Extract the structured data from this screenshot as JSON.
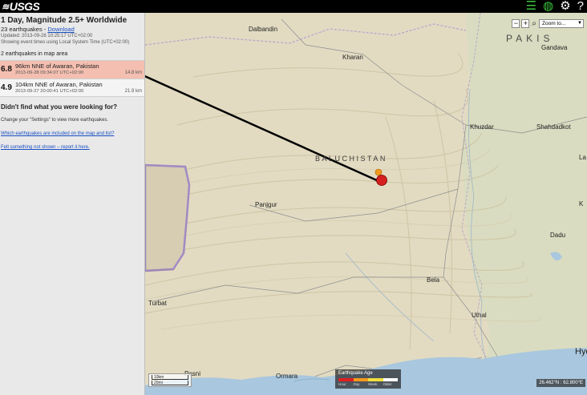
{
  "header": {
    "logo_text": "USGS",
    "icons": [
      "list-icon",
      "globe-icon",
      "gear-icon",
      "help-icon"
    ]
  },
  "sidebar": {
    "title": "1 Day, Magnitude 2.5+ Worldwide",
    "count_label": "23 earthquakes",
    "download_link": "Download",
    "updated": "Updated: 2013-09-28 10:25:17 UTC+02:00",
    "timezone_note": "Showing event times using Local System Time (UTC+02:00)",
    "map_area_label": "2 earthquakes in map area",
    "earthquakes": [
      {
        "mag": "6.8",
        "place": "96km NNE of Awaran, Pakistan",
        "time": "2013-09-28 09:34:07 UTC+02:00",
        "depth": "14.8 km"
      },
      {
        "mag": "4.9",
        "place": "104km NNE of Awaran, Pakistan",
        "time": "2013-09-27 20:00:41 UTC+02:00",
        "depth": "21.9 km"
      }
    ],
    "help_title": "Didn't find what you were looking for?",
    "help_text": "Change your \"Settings\" to view more earthquakes.",
    "help_link_1": "Which earthquakes are included on the map and list?",
    "help_link_2": "Felt something not shown – report it here."
  },
  "map": {
    "cities": {
      "dalbandin": "Dalbandin",
      "kharan": "Kharan",
      "khuzdar": "Khuzdar",
      "panjgur": "Panjgur",
      "turbat": "Turbat",
      "bela": "Bela",
      "uthal": "Uthal",
      "pasni": "Pasni",
      "ormara": "Ormara",
      "gandava": "Gandava",
      "shahdadkot": "Shahdadkot",
      "dadu": "Dadu",
      "hyd": "Hyd",
      "la": "La",
      "ka": "K"
    },
    "region_label": "BALUCHISTAN",
    "country_label": "PAKIS",
    "zoom_select": "Zoom to...",
    "legend_title": "Earthquake Age",
    "legend_labels": [
      "Hour",
      "Day",
      "Week",
      "Older"
    ],
    "legend_colors": [
      "#e02020",
      "#f29a1e",
      "#f0e040",
      "#ffffff"
    ],
    "scale_top": "10km",
    "scale_bottom": "20mi",
    "coordinates": "26.462°N : 62.800°E",
    "marker_colors": {
      "recent": "#d62020",
      "day": "#f29a1e"
    }
  }
}
